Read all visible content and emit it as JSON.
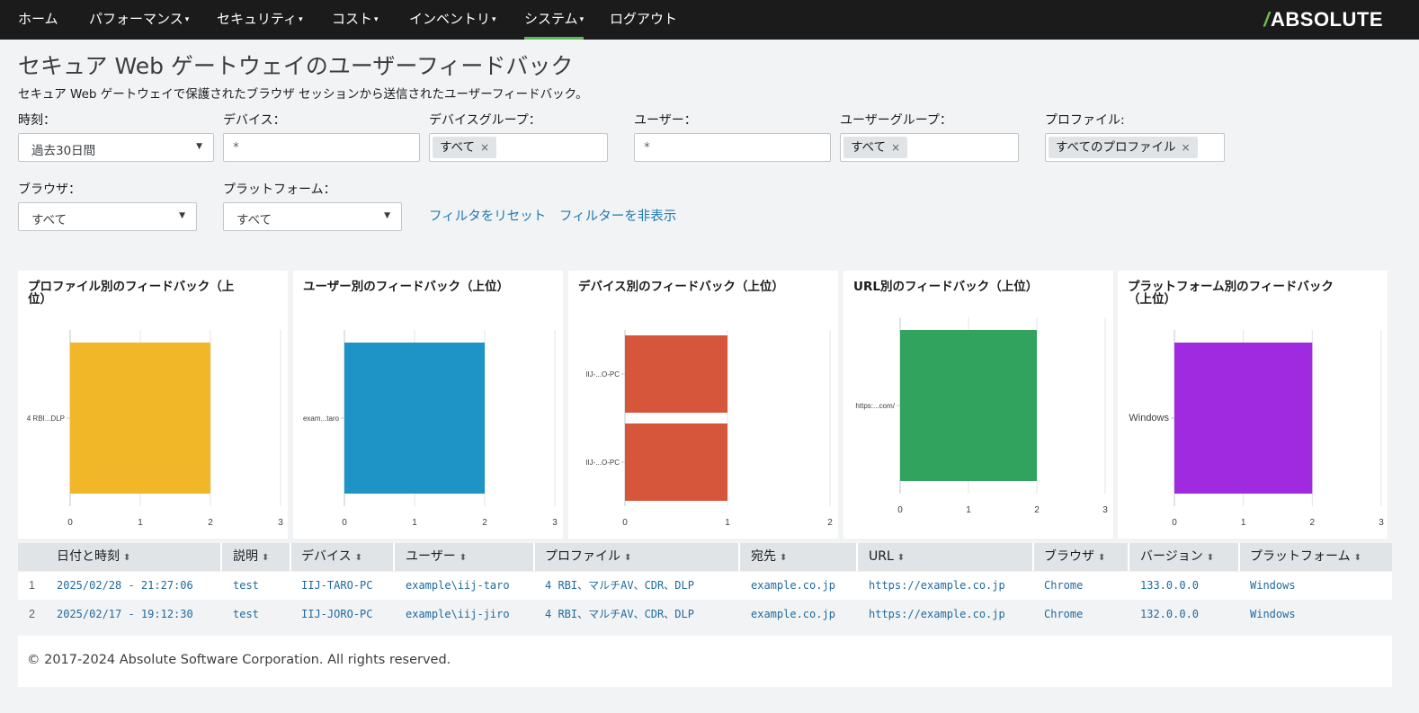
{
  "nav": {
    "items": [
      {
        "label": "ホーム",
        "caret": false
      },
      {
        "label": "パフォーマンス",
        "caret": true
      },
      {
        "label": "セキュリティ",
        "caret": true
      },
      {
        "label": "コスト",
        "caret": true
      },
      {
        "label": "インベントリ",
        "caret": true
      },
      {
        "label": "システム",
        "caret": true,
        "active": true
      },
      {
        "label": "ログアウト",
        "caret": false
      }
    ],
    "brand": "ABSOLUTE",
    "brand_slash": "/",
    "caret_glyph": "▾"
  },
  "page": {
    "title": "セキュア Web ゲートウェイのユーザーフィードバック",
    "subtitle": "セキュア Web ゲートウェイで保護されたブラウザ セッションから送信されたユーザーフィードバック。"
  },
  "filters": {
    "time": {
      "label": "時刻：",
      "value": "過去30日間"
    },
    "device": {
      "label": "デバイス：",
      "value": "*"
    },
    "device_group": {
      "label": "デバイスグループ：",
      "tag": "すべて"
    },
    "user": {
      "label": "ユーザー：",
      "value": "*"
    },
    "user_group": {
      "label": "ユーザーグループ：",
      "tag": "すべて"
    },
    "profile": {
      "label": "プロファイル:",
      "tag": "すべてのプロファイル"
    },
    "browser": {
      "label": "ブラウザ：",
      "value": "すべて"
    },
    "platform": {
      "label": "プラットフォーム：",
      "value": "すべて"
    },
    "reset_link": "フィルタをリセット",
    "hide_link": "フィルターを非表示",
    "tag_close_glyph": "×",
    "dropdown_glyph": "▼"
  },
  "chart_data": [
    {
      "type": "bar",
      "orientation": "horizontal",
      "title": "プロファイル別のフィードバック（上位）",
      "categories": [
        "4 RBI...DLP"
      ],
      "values": [
        2
      ],
      "xlim": [
        0,
        3
      ],
      "xticks": [
        "0",
        "1",
        "2",
        "3"
      ],
      "color": "#f2b728"
    },
    {
      "type": "bar",
      "orientation": "horizontal",
      "title": "ユーザー別のフィードバック（上位）",
      "categories": [
        "exam...taro"
      ],
      "values": [
        2
      ],
      "xlim": [
        0,
        3
      ],
      "xticks": [
        "0",
        "1",
        "2",
        "3"
      ],
      "color": "#1e93c6"
    },
    {
      "type": "bar",
      "orientation": "horizontal",
      "title": "デバイス別のフィードバック（上位）",
      "categories": [
        "IIJ-...O-PC",
        "IIJ-...O-PC"
      ],
      "values": [
        1,
        1
      ],
      "xlim": [
        0,
        2
      ],
      "xticks": [
        "0",
        "1",
        "2"
      ],
      "color": "#d6563c"
    },
    {
      "type": "bar",
      "orientation": "horizontal",
      "title": "URL別のフィードバック（上位）",
      "categories": [
        "https:...com/"
      ],
      "values": [
        2
      ],
      "xlim": [
        0,
        3
      ],
      "xticks": [
        "0",
        "1",
        "2",
        "3"
      ],
      "color": "#31a35f"
    },
    {
      "type": "bar",
      "orientation": "horizontal",
      "title": "プラットフォーム別のフィードバック（上位）",
      "categories": [
        "Windows"
      ],
      "values": [
        2
      ],
      "xlim": [
        0,
        3
      ],
      "xticks": [
        "0",
        "1",
        "2",
        "3"
      ],
      "color": "#a02ae0"
    }
  ],
  "table": {
    "columns": [
      "日付と時刻",
      "説明",
      "デバイス",
      "ユーザー",
      "プロファイル",
      "宛先",
      "URL",
      "ブラウザ",
      "バージョン",
      "プラットフォーム"
    ],
    "sort_glyph": "⬍",
    "rows": [
      {
        "num": "1",
        "cells": [
          "2025/02/28 - 21:27:06",
          "test",
          "IIJ-TARO-PC",
          "example\\iij-taro",
          "4 RBI、マルチAV、CDR、DLP",
          "example.co.jp",
          "https://example.co.jp",
          "Chrome",
          "133.0.0.0",
          "Windows"
        ]
      },
      {
        "num": "2",
        "cells": [
          "2025/02/17 - 19:12:30",
          "test",
          "IIJ-JORO-PC",
          "example\\iij-jiro",
          "4 RBI、マルチAV、CDR、DLP",
          "example.co.jp",
          "https://example.co.jp",
          "Chrome",
          "132.0.0.0",
          "Windows"
        ]
      }
    ]
  },
  "footer": {
    "copyright": "© 2017-2024 Absolute Software Corporation. All rights reserved."
  }
}
